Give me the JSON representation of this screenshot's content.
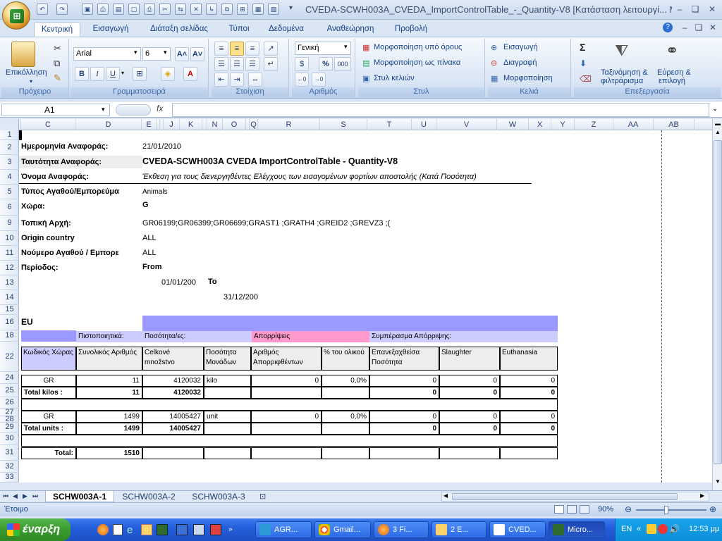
{
  "window": {
    "title": "CVEDA-SCWH003A_CVEDA_ImportControlTable_-_Quantity-V8  [Κατάσταση λειτουργί... Μ",
    "min": "–",
    "restore": "❏",
    "close": "✕",
    "doc_min": "–",
    "doc_restore": "❏",
    "doc_close": "✕"
  },
  "ribbon_tabs": [
    "Κεντρική",
    "Εισαγωγή",
    "Διάταξη σελίδας",
    "Τύποι",
    "Δεδομένα",
    "Αναθεώρηση",
    "Προβολή"
  ],
  "ribbon": {
    "clipboard": {
      "paste": "Επικόλληση",
      "label": "Πρόχειρο"
    },
    "font": {
      "name": "Arial",
      "size": "6",
      "bold": "B",
      "italic": "I",
      "underline": "U",
      "grow": "A˄",
      "shrink": "A˅",
      "label": "Γραμματοσειρά"
    },
    "alignment": {
      "label": "Στοίχιση"
    },
    "number": {
      "format": "Γενική",
      "percent": "%",
      "thousands": "000",
      "label": "Αριθμός"
    },
    "styles": {
      "cond": "Μορφοποίηση υπό όρους",
      "table": "Μορφοποίηση ως πίνακα",
      "cell": "Στυλ κελιών",
      "label": "Στυλ"
    },
    "cells": {
      "insert": "Εισαγωγή",
      "delete": "Διαγραφή",
      "format": "Μορφοποίηση",
      "label": "Κελιά"
    },
    "editing": {
      "sigma": "Σ",
      "sort_line1": "Ταξινόμηση &",
      "sort_line2": "φιλτράρισμα",
      "find_line1": "Εύρεση &",
      "find_line2": "επιλογή",
      "label": "Επεξεργασία"
    }
  },
  "formula_bar": {
    "name_box": "A1",
    "fx": "fx",
    "value": ""
  },
  "columns": [
    {
      "id": "A",
      "w": 3
    },
    {
      "id": "C",
      "w": 77
    },
    {
      "id": "D",
      "w": 94
    },
    {
      "id": "E",
      "w": 21
    },
    {
      "id": "H",
      "w": 5
    },
    {
      "id": "I",
      "w": 5
    },
    {
      "id": "J",
      "w": 23
    },
    {
      "id": "K",
      "w": 32
    },
    {
      "id": "L",
      "w": 7
    },
    {
      "id": "N",
      "w": 22
    },
    {
      "id": "O",
      "w": 33
    },
    {
      "id": "P",
      "w": 5
    },
    {
      "id": "Q",
      "w": 12
    },
    {
      "id": "R",
      "w": 88
    },
    {
      "id": "S",
      "w": 67
    },
    {
      "id": "T",
      "w": 63
    },
    {
      "id": "U",
      "w": 35
    },
    {
      "id": "V",
      "w": 86
    },
    {
      "id": "W",
      "w": 45
    },
    {
      "id": "X",
      "w": 32
    },
    {
      "id": "Y",
      "w": 33
    },
    {
      "id": "Z",
      "w": 55
    },
    {
      "id": "AA",
      "w": 57
    },
    {
      "id": "AB",
      "w": 58
    }
  ],
  "rows": [
    "1",
    "2",
    "3",
    "4",
    "5",
    "6",
    "9",
    "10",
    "11",
    "12",
    "13",
    "14",
    "15",
    "16",
    "18",
    "22",
    "24",
    "25",
    "26",
    "27",
    "28",
    "29",
    "30",
    "31",
    "32",
    "33"
  ],
  "report": {
    "date_label": "Ημερομηνία Αναφοράς:",
    "date_value": "21/01/2010",
    "id_label": "Ταυτότητα Αναφοράς:",
    "id_value": "CVEDA-SCWH003A CVEDA ImportControlTable - Quantity-V8",
    "name_label": "Όνομα Αναφοράς:",
    "name_value": "Έκθεση για τους διενεργηθέντες Ελέγχους των εισαγομένων φορτίων αποστολής (Κατά Ποσότητα)",
    "type_label": "Τύπος Αγαθού/Εμπορεύμα",
    "type_value": "Animals",
    "country_label": "Χώρα:",
    "country_value": "G",
    "authority_label": "Τοπική Αρχή:",
    "authority_value": "GR06199;GR06399;GR06699;GRAST1 ;GRATH4 ;GREID2 ;GREVZ3 ;(",
    "origin_label": "Origin country",
    "origin_value": "ALL",
    "goods_no_label": "Νούμερο Αγαθού / Εμπορε",
    "goods_no_value": "ALL",
    "period_label": "Περίοδος:",
    "from_label": "From",
    "from_value": "01/01/200",
    "to_label": "To",
    "to_value": "31/12/200"
  },
  "table": {
    "region": "EU",
    "group_headers": {
      "cert": "Πιστοποιητικά:",
      "qty": "Ποσότητα/ες:",
      "rej": "Απορρίψεις",
      "concl": "Συμπέρασμα Απόρριψης:"
    },
    "col_headers": [
      "Κωδικός Χώρας",
      "Συνολικός Αριθμός",
      "Celkové množstvo",
      "Ποσότητα Μονάδων",
      "Αριθμός Απορριφθέντων",
      "% του ολικού",
      "Επανεξαχθείσα Ποσότητα",
      "Slaughter",
      "Euthanasia"
    ],
    "rows": [
      {
        "c0": "GR",
        "c1": "11",
        "c2": "4120032",
        "c3": "kilo",
        "c4": "0",
        "c5": "0,0%",
        "c6": "0",
        "c7": "0",
        "c8": "0"
      },
      {
        "c0": "Total kilos :",
        "c1": "11",
        "c2": "4120032",
        "c3": "",
        "c4": "",
        "c5": "",
        "c6": "0",
        "c7": "0",
        "c8": "0"
      },
      {
        "c0": "GR",
        "c1": "1499",
        "c2": "14005427",
        "c3": "unit",
        "c4": "0",
        "c5": "0,0%",
        "c6": "0",
        "c7": "0",
        "c8": "0"
      },
      {
        "c0": "Total units :",
        "c1": "1499",
        "c2": "14005427",
        "c3": "",
        "c4": "",
        "c5": "",
        "c6": "0",
        "c7": "0",
        "c8": "0"
      }
    ],
    "total_label": "Total:",
    "total_value": "1510"
  },
  "sheet_tabs": [
    "SCHW003A-1",
    "SCHW003A-2",
    "SCHW003A-3"
  ],
  "status": {
    "ready": "Έτοιμο",
    "zoom": "90%"
  },
  "taskbar": {
    "start": "έναρξη",
    "items": [
      "AGR...",
      "Gmail...",
      "3 Fi...",
      "2 E...",
      "CVED...",
      "Micro..."
    ],
    "lang": "EN",
    "clock": "12:53 μμ"
  },
  "colors": {
    "accent": "#9999ff",
    "pink": "#ff99cc",
    "lavender": "#ccccff",
    "header_fill": "#ededed"
  }
}
